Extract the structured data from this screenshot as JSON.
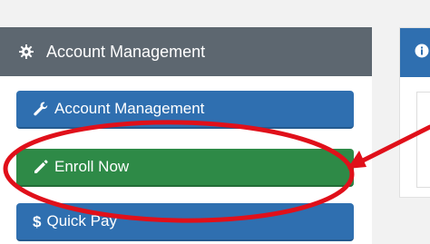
{
  "sidebar": {
    "header_title": "Account Management",
    "buttons": [
      {
        "label": "Account Management",
        "icon": "wrench-icon"
      },
      {
        "label": "Enroll Now",
        "icon": "pencil-icon"
      },
      {
        "label": "Quick Pay",
        "icon": "dollar-icon"
      }
    ],
    "quick_pay_symbol": "$"
  },
  "right_panel": {
    "header_icon": "info-circle-icon"
  },
  "colors": {
    "header_gray": "#5d6770",
    "button_blue": "#2f6fb0",
    "button_green": "#2e8a47",
    "annotation_red": "#e0101a"
  }
}
